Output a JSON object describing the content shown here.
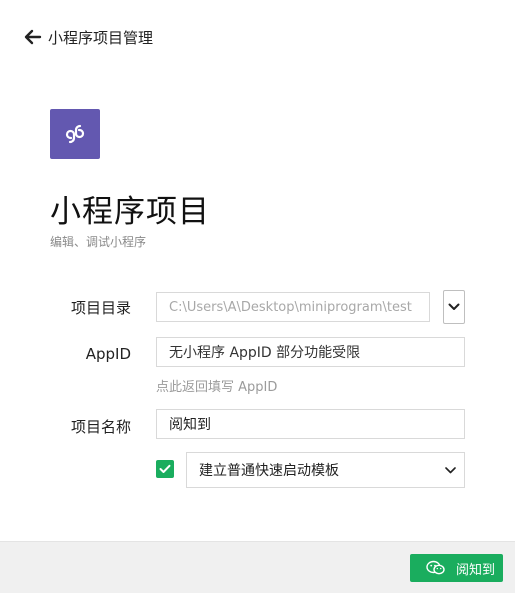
{
  "header": {
    "back_label": "小程序项目管理"
  },
  "project": {
    "title": "小程序项目",
    "subtitle": "编辑、调试小程序"
  },
  "form": {
    "directory": {
      "label": "项目目录",
      "placeholder": "C:\\Users\\A\\Desktop\\miniprogram\\test"
    },
    "appid": {
      "label": "AppID",
      "value": "无小程序 AppID 部分功能受限",
      "hint": "点此返回填写 AppID"
    },
    "name": {
      "label": "项目名称",
      "value": "阅知到"
    },
    "template": {
      "checked": true,
      "selected": "建立普通快速启动模板"
    }
  },
  "footer": {
    "confirm_label": "阅知到"
  },
  "colors": {
    "logo_bg": "#6358b0",
    "accent_green": "#1aad5e",
    "footer_bg": "#f0f0f0"
  },
  "icons": {
    "back": "arrow-left-icon",
    "logo": "miniprogram-logo-icon",
    "dropdown": "chevron-down-icon",
    "check": "check-icon",
    "watermark": "wechat-icon"
  }
}
